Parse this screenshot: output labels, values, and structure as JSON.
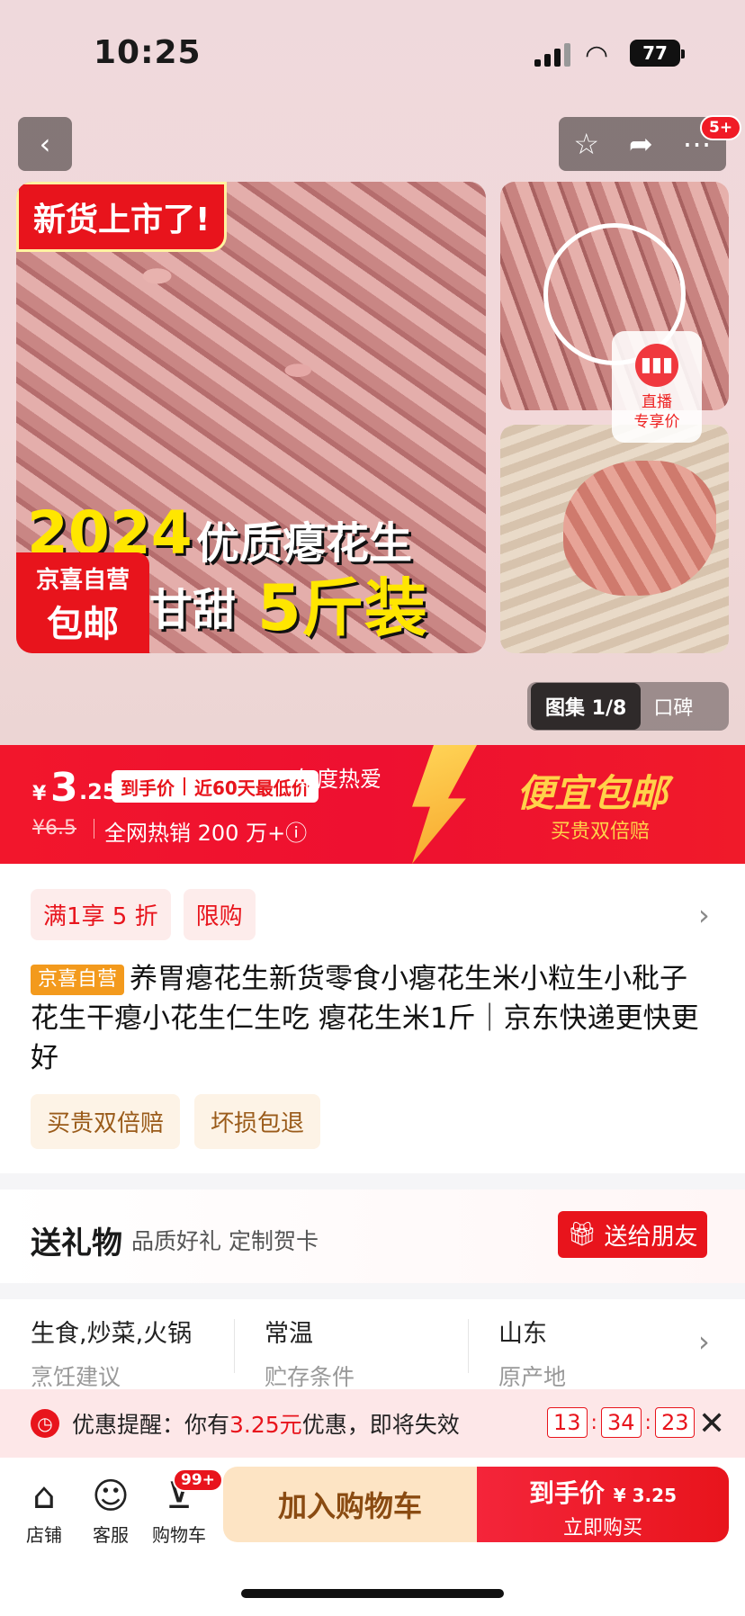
{
  "status": {
    "time": "10:25",
    "battery": "77"
  },
  "nav": {
    "back": "‹",
    "notif_badge": "5+"
  },
  "hero": {
    "new_tag": "新货上市了!",
    "year": "2024",
    "quality": "优质瘪花生",
    "sweet": "甘甜",
    "weight": "5斤装",
    "jx_top": "京喜自营",
    "jx_bottom": "包邮",
    "live_line1": "直播",
    "live_line2": "专享价",
    "gallery_active": "图集 1/8",
    "gallery_other": "口碑"
  },
  "price_banner": {
    "currency": "¥",
    "price_int": "3",
    "price_dec": ".25",
    "tag_a": "到手价",
    "tag_b": "近60天最低价",
    "heat": "年度热爱",
    "old_price": "¥6.5",
    "sold": "全网热销 200 万+ⓘ",
    "free_ship": "便宜包邮",
    "double": "买贵双倍赔"
  },
  "promos": [
    "满1享 5 折",
    "限购"
  ],
  "product": {
    "self_tag": "京喜自营",
    "title": "养胃瘪花生新货零食小瘪花生米小粒生小秕子花生干瘪小花生仁生吃 瘪花生米1斤｜京东快递更快更好"
  },
  "guarantees": [
    "买贵双倍赔",
    "坏损包退"
  ],
  "gift": {
    "title": "送礼物",
    "subtitle": "品质好礼 定制贺卡",
    "button": "送给朋友"
  },
  "specs": [
    {
      "value": "生食,炒菜,火锅",
      "key": "烹饪建议"
    },
    {
      "value": "常温",
      "key": "贮存条件"
    },
    {
      "value": "山东",
      "key": "原产地"
    }
  ],
  "reminder": {
    "prefix": "优惠提醒：你有",
    "amount": "3.25元",
    "suffix": "优惠，即将失效",
    "h": "13",
    "m": "34",
    "s": "23"
  },
  "bottom": {
    "shop": "店铺",
    "service": "客服",
    "cart": "购物车",
    "cart_badge": "99+",
    "add_cart": "加入购物车",
    "buy_price_label": "到手价",
    "buy_price": "¥ 3.25",
    "buy_now": "立即购买"
  }
}
